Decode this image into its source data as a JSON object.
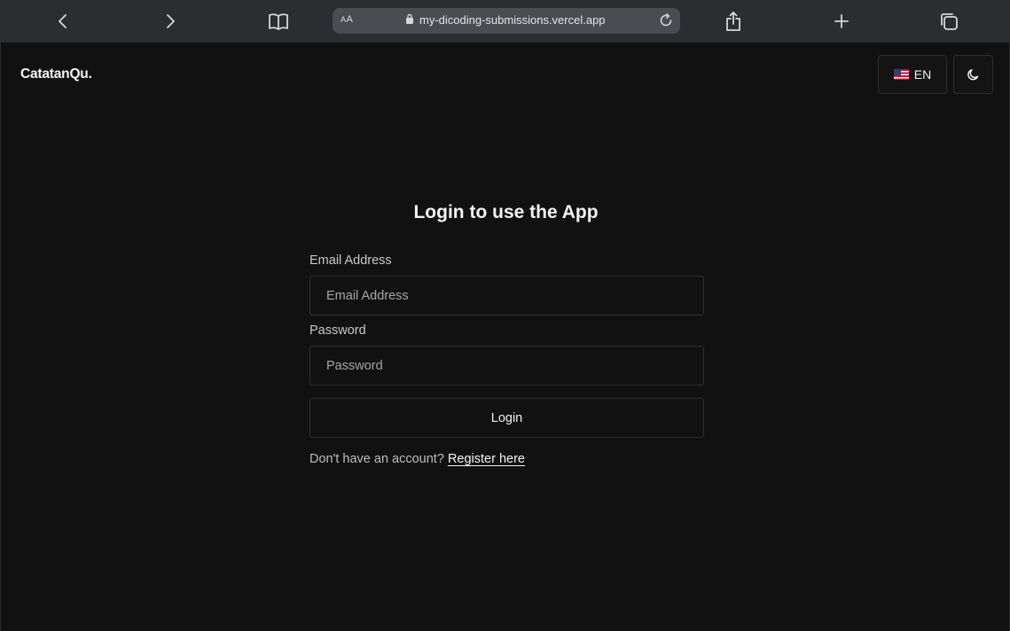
{
  "browser": {
    "text_size_label": "AA",
    "url": "my-dicoding-submissions.vercel.app"
  },
  "header": {
    "brand": "CatatanQu.",
    "language_label": "EN"
  },
  "login": {
    "title": "Login to use the App",
    "email_label": "Email Address",
    "email_placeholder": "Email Address",
    "email_value": "",
    "password_label": "Password",
    "password_placeholder": "Password",
    "password_value": "",
    "submit_label": "Login",
    "register_prompt": "Don't have an account?",
    "register_link": "Register here"
  },
  "colors": {
    "background": "#111111",
    "toolbar": "#2b2d31",
    "addressbar": "#4a4c52",
    "border": "#2f2f2f",
    "text": "#f3f3f3"
  },
  "icons": [
    "back-icon",
    "forward-icon",
    "bookmarks-icon",
    "lock-icon",
    "reload-icon",
    "share-icon",
    "new-tab-icon",
    "tabs-icon",
    "flag-us-icon",
    "moon-icon"
  ]
}
